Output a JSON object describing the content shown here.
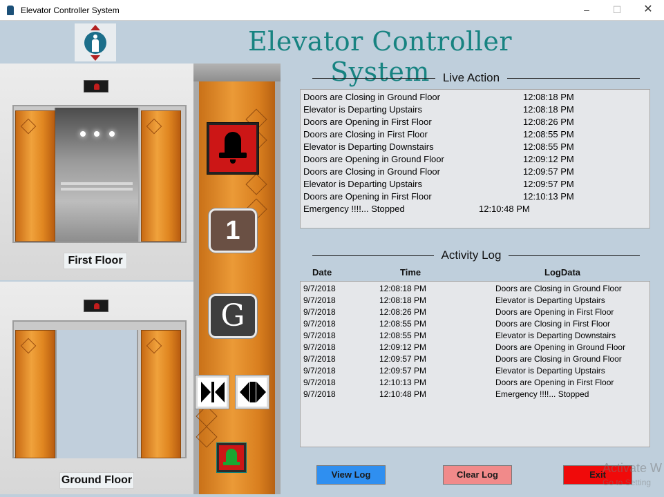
{
  "window": {
    "title": "Elevator Controller System",
    "minimize": "–",
    "maximize": "☐",
    "close": "✕"
  },
  "header": {
    "title": "Elevator Controller System"
  },
  "floors": {
    "first_label": "First Floor",
    "ground_label": "Ground Floor"
  },
  "panel": {
    "floor1_label": "1",
    "floorG_label": "G"
  },
  "live_action": {
    "title": "Live Action",
    "rows": [
      {
        "event": "Doors are Closing in Ground Floor",
        "time": "12:08:18 PM"
      },
      {
        "event": "Elevator is Departing Upstairs",
        "time": "12:08:18 PM"
      },
      {
        "event": "Doors are Opening in First Floor",
        "time": "12:08:26 PM"
      },
      {
        "event": "Doors are Closing in First Floor",
        "time": "12:08:55 PM"
      },
      {
        "event": "Elevator is Departing Downstairs",
        "time": "12:08:55 PM"
      },
      {
        "event": "Doors are Opening in Ground Floor",
        "time": "12:09:12 PM"
      },
      {
        "event": "Doors are Closing in Ground Floor",
        "time": "12:09:57 PM"
      },
      {
        "event": "Elevator is Departing Upstairs",
        "time": "12:09:57 PM"
      },
      {
        "event": "Doors are Opening in First Floor",
        "time": "12:10:13 PM"
      },
      {
        "event": "Emergency !!!!... Stopped",
        "time": "12:10:48 PM"
      }
    ]
  },
  "activity_log": {
    "title": "Activity Log",
    "columns": [
      "Date",
      "Time",
      "LogData"
    ],
    "rows": [
      {
        "date": "9/7/2018",
        "time": "12:08:18 PM",
        "log": "Doors are Closing in Ground Floor"
      },
      {
        "date": "9/7/2018",
        "time": "12:08:18 PM",
        "log": "Elevator is Departing Upstairs"
      },
      {
        "date": "9/7/2018",
        "time": "12:08:26 PM",
        "log": "Doors are Opening in First Floor"
      },
      {
        "date": "9/7/2018",
        "time": "12:08:55 PM",
        "log": "Doors are Closing in First Floor"
      },
      {
        "date": "9/7/2018",
        "time": "12:08:55 PM",
        "log": "Elevator is Departing Downstairs"
      },
      {
        "date": "9/7/2018",
        "time": "12:09:12 PM",
        "log": "Doors are Opening in Ground Floor"
      },
      {
        "date": "9/7/2018",
        "time": "12:09:57 PM",
        "log": "Doors are Closing in Ground Floor"
      },
      {
        "date": "9/7/2018",
        "time": "12:09:57 PM",
        "log": "Elevator is Departing Upstairs"
      },
      {
        "date": "9/7/2018",
        "time": "12:10:13 PM",
        "log": "Doors are Opening in First Floor"
      },
      {
        "date": "9/7/2018",
        "time": "12:10:48 PM",
        "log": "Emergency !!!!... Stopped"
      }
    ]
  },
  "buttons": {
    "view_log": "View Log",
    "clear_log": "Clear Log",
    "exit": "Exit"
  },
  "watermark": {
    "line1": "Activate W",
    "line2": "Go to Setting"
  },
  "colors": {
    "accent_title": "#178381",
    "view_log": "#2f8ff0",
    "clear_log": "#f18a8a",
    "exit": "#f00a0a",
    "alarm": "#cc1616"
  }
}
